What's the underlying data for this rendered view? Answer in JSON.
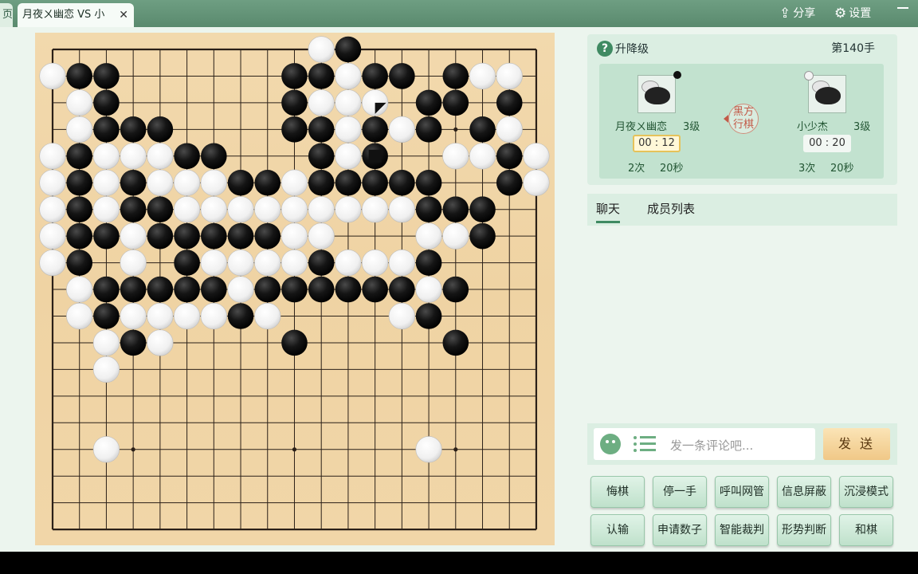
{
  "titlebar": {
    "prev_tab_label": "页",
    "active_tab": {
      "title": "月夜ㄨ幽恋 VS 小",
      "close": "✕"
    },
    "share_label": "分享",
    "settings_label": "设置"
  },
  "game": {
    "board_size": 19,
    "star_points": [
      [
        3,
        3
      ],
      [
        3,
        9
      ],
      [
        3,
        15
      ],
      [
        9,
        3
      ],
      [
        9,
        9
      ],
      [
        9,
        15
      ],
      [
        15,
        3
      ],
      [
        15,
        9
      ],
      [
        15,
        15
      ]
    ],
    "board_rows": [
      "..........WB.......",
      "WBB......BBWBB.BWW.",
      ".WB......BWWW.BB.B.",
      ".WBBB....BBWBWB.BW.",
      "WBWWWBB...BWB..WWBW",
      "WBWBWWWBBWBBBBB..BW",
      "WBWBBWWWWWWWWWBBB..",
      "WBBWBBBBBWW...WWB..",
      "WB.W.BWWWWBWWWB....",
      ".WBBBBBWBBBBBBWB...",
      ".WBWWWWBW....WB....",
      "..WBW....B.....B...",
      "..W................",
      "...................",
      "...................",
      "..W...........W....",
      "...................",
      "...................",
      "..................."
    ],
    "last_move": [
      2,
      12
    ],
    "territory_mark": [
      4,
      12
    ],
    "move_label": "第140手"
  },
  "panel": {
    "help_icon": "?",
    "rank_label": "升降级",
    "black_player": {
      "name": "月夜ㄨ幽恋",
      "rank": "3级",
      "clock": "00 : 12",
      "periods": "2次",
      "seconds": "20秒"
    },
    "white_player": {
      "name": "小少杰",
      "rank": "3级",
      "clock": "00 : 20",
      "periods": "3次",
      "seconds": "20秒"
    },
    "turn_seal_line1": "黑方",
    "turn_seal_line2": "行棋",
    "colors": {
      "accent": "#3f8a62",
      "panel": "#dbeee2",
      "board": "#f0d5a6",
      "send": "#f0c887"
    }
  },
  "chat": {
    "tabs": [
      "聊天",
      "成员列表"
    ],
    "placeholder": "发一条评论吧...",
    "send_label": "发 送",
    "emoji_icon": "smiley-icon",
    "list_icon": "list-icon"
  },
  "actions": {
    "row1": [
      "悔棋",
      "停一手",
      "呼叫网管",
      "信息屏蔽",
      "沉浸模式"
    ],
    "row2": [
      "认输",
      "申请数子",
      "智能裁判",
      "形势判断",
      "和棋"
    ]
  }
}
